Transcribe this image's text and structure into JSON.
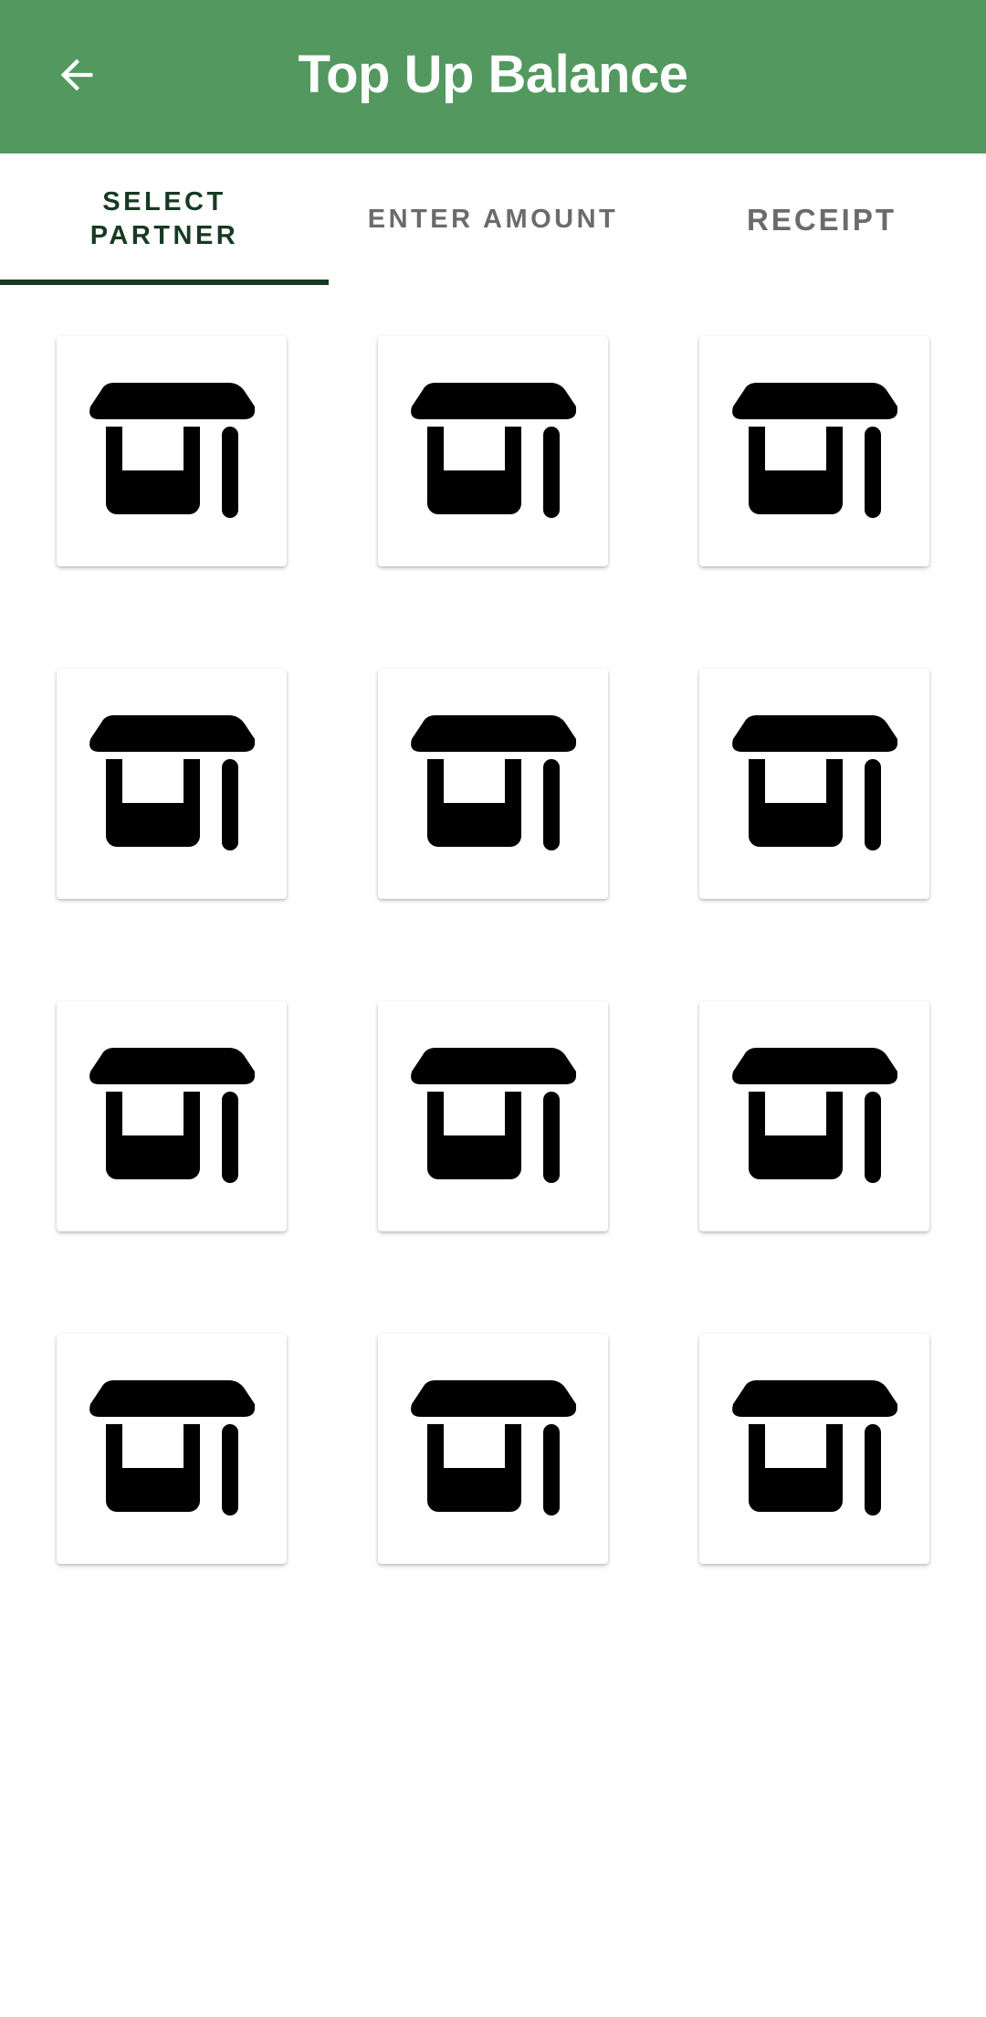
{
  "app_bar": {
    "title": "Top Up Balance",
    "back_icon": "arrow-left-icon",
    "background": "#52985f"
  },
  "tabs": [
    {
      "label": "SELECT PARTNER",
      "active": true
    },
    {
      "label": "ENTER AMOUNT",
      "active": false
    },
    {
      "label": "RECEIPT",
      "active": false
    }
  ],
  "partners": {
    "icon": "store-icon",
    "count": 12
  },
  "colors": {
    "accent": "#52985f",
    "tab_active": "#173a22",
    "tab_inactive": "#6b6b6b"
  }
}
